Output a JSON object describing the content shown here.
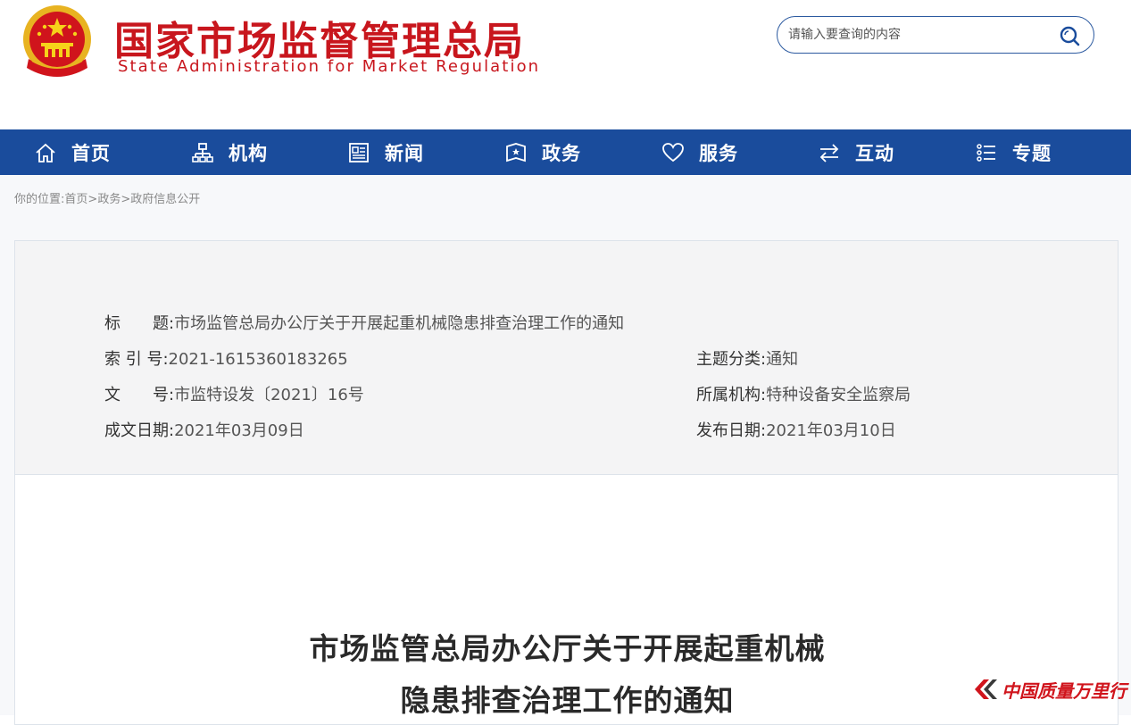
{
  "header": {
    "title_cn": "国家市场监督管理总局",
    "title_en": "State Administration for Market Regulation",
    "emblem_icon": "national-emblem-icon",
    "brand_color": "#c8161d"
  },
  "search": {
    "placeholder": "请输入要查询的内容",
    "icon": "search-icon",
    "border_color": "#2c5aa0"
  },
  "nav": {
    "bg_color": "#1a4c9c",
    "items": [
      {
        "label": "首页",
        "icon": "home-icon"
      },
      {
        "label": "机构",
        "icon": "org-chart-icon"
      },
      {
        "label": "新闻",
        "icon": "newspaper-icon"
      },
      {
        "label": "政务",
        "icon": "government-icon"
      },
      {
        "label": "服务",
        "icon": "heart-icon"
      },
      {
        "label": "互动",
        "icon": "exchange-icon"
      },
      {
        "label": "专题",
        "icon": "topic-list-icon"
      }
    ]
  },
  "breadcrumb": {
    "prefix": "你的位置:",
    "items": [
      "首页",
      "政务",
      "政府信息公开"
    ],
    "separator": ">"
  },
  "meta": {
    "title_label": "标　　题:",
    "title_value": "市场监管总局办公厅关于开展起重机械隐患排查治理工作的通知",
    "index_label": "索 引 号:",
    "index_value": "2021-1615360183265",
    "category_label": "主题分类:",
    "category_value": "通知",
    "docno_label": "文　　号:",
    "docno_value": "市监特设发〔2021〕16号",
    "agency_label": "所属机构:",
    "agency_value": "特种设备安全监察局",
    "written_label": "成文日期:",
    "written_value": "2021年03月09日",
    "published_label": "发布日期:",
    "published_value": "2021年03月10日"
  },
  "document": {
    "title_line1": "市场监管总局办公厅关于开展起重机械",
    "title_line2": "隐患排查治理工作的通知"
  },
  "watermark": {
    "text": "中国质量万里行",
    "color": "#d0141c"
  }
}
